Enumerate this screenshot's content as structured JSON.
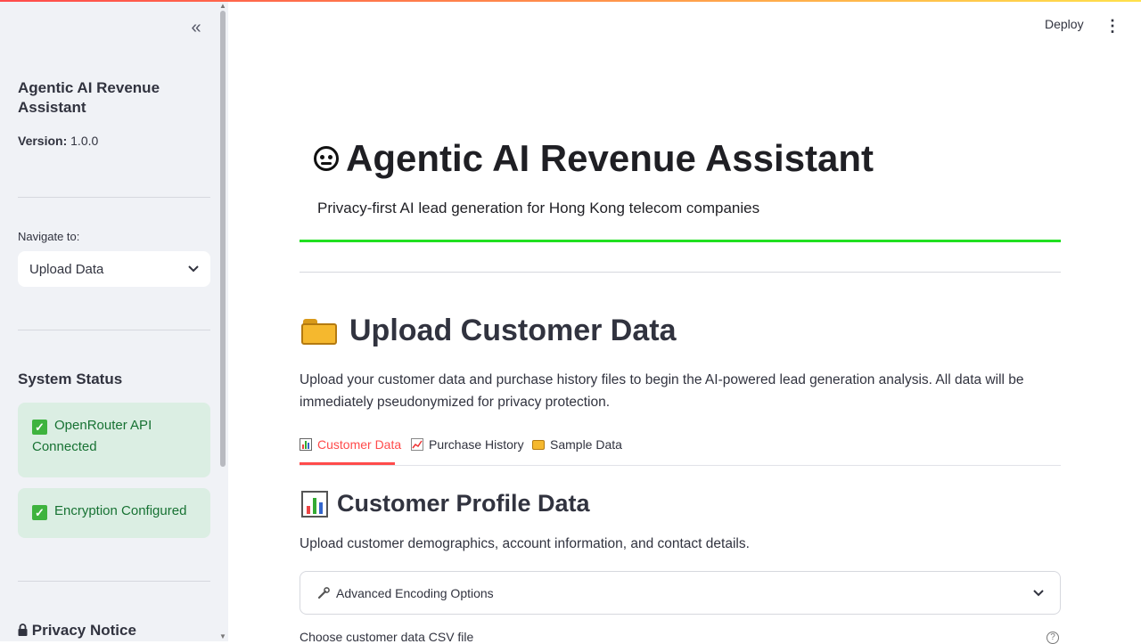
{
  "sidebar": {
    "collapse_glyph": "«",
    "app_title": "Agentic AI Revenue Assistant",
    "version_label": "Version:",
    "version_value": "1.0.0",
    "nav_label": "Navigate to:",
    "nav_selected": "Upload Data",
    "system_status_heading": "System Status",
    "status_items": [
      {
        "text": "OpenRouter API Connected"
      },
      {
        "text": "Encryption Configured"
      }
    ],
    "privacy_heading": "Privacy Notice",
    "colors": {
      "background": "#f0f2f6",
      "status_bg": "#dbeee3",
      "status_text": "#177233"
    }
  },
  "header": {
    "deploy_label": "Deploy",
    "menu_glyph": "⋮"
  },
  "main": {
    "title": "Agentic AI Revenue Assistant",
    "subtitle": "Privacy-first AI lead generation for Hong Kong telecom companies",
    "section_heading": "Upload Customer Data",
    "section_description": "Upload your customer data and purchase history files to begin the AI-powered lead generation analysis. All data will be immediately pseudonymized for privacy protection.",
    "tabs": [
      {
        "label": "Customer Data",
        "active": true,
        "icon": "bar-chart-icon"
      },
      {
        "label": "Purchase History",
        "active": false,
        "icon": "line-chart-icon"
      },
      {
        "label": "Sample Data",
        "active": false,
        "icon": "folder-icon"
      }
    ],
    "subsection_heading": "Customer Profile Data",
    "subsection_description": "Upload customer demographics, account information, and contact details.",
    "expander_label": "Advanced Encoding Options",
    "file_input_label": "Choose customer data CSV file",
    "colors": {
      "accent": "#ff4b4b",
      "divider_green": "#21e021"
    }
  }
}
